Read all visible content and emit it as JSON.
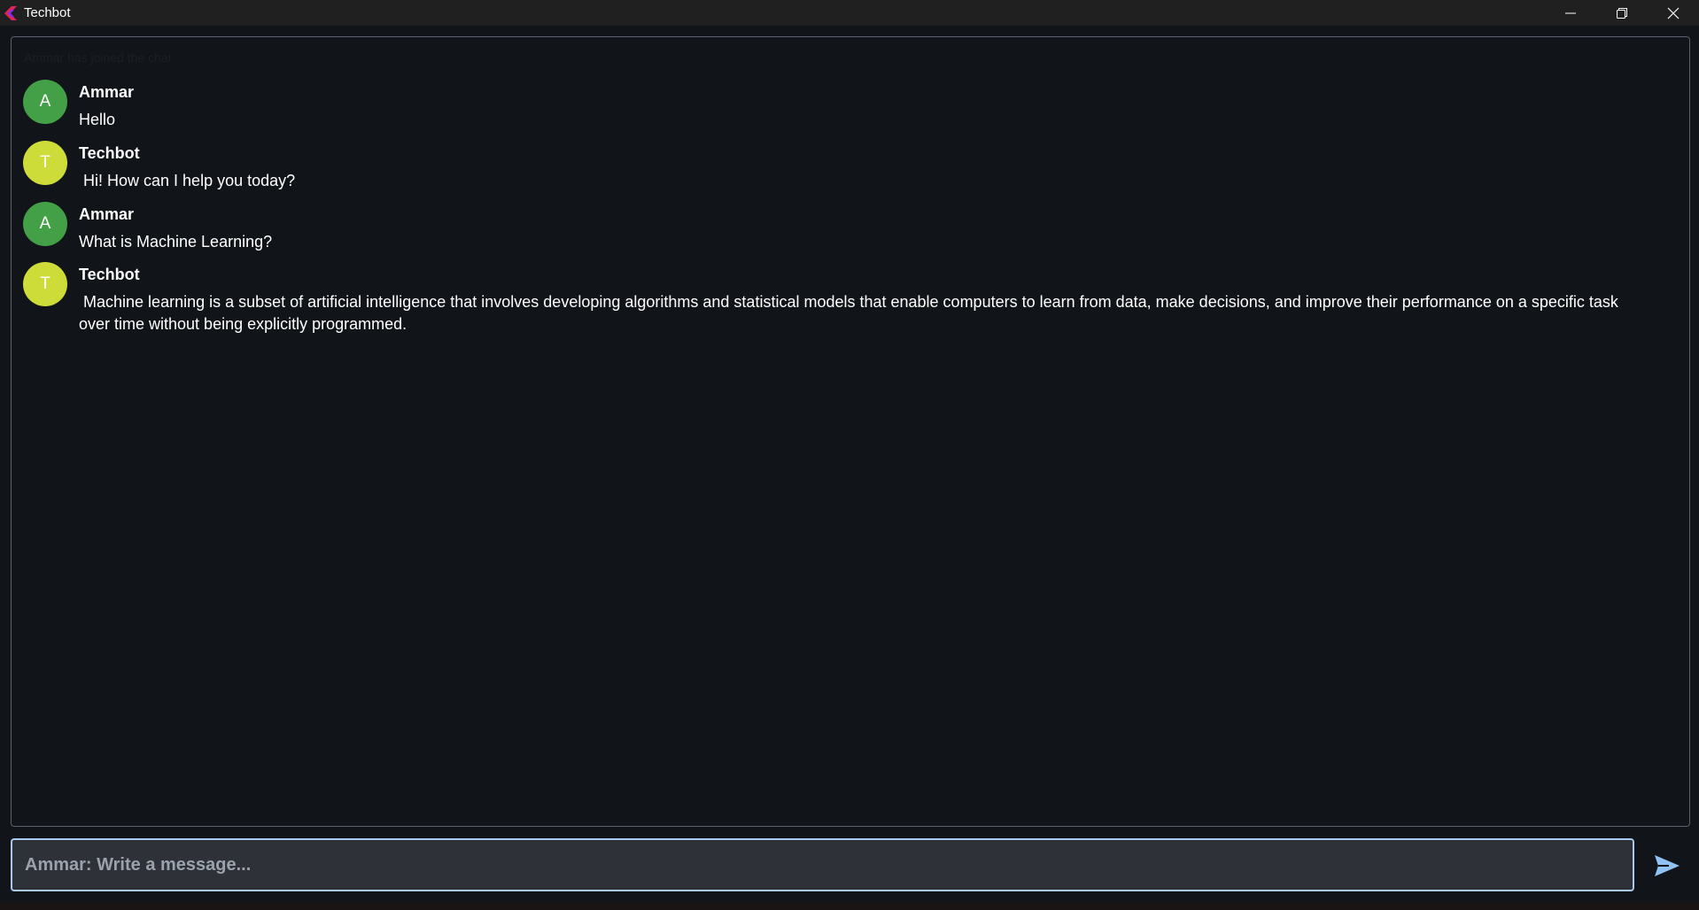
{
  "window": {
    "title": "Techbot"
  },
  "chat": {
    "system_notice": "Ammar has joined the chat",
    "messages": [
      {
        "author": "Ammar",
        "initial": "A",
        "text": "Hello",
        "avatar_color": "#43a047"
      },
      {
        "author": "Techbot",
        "initial": "T",
        "text": " Hi! How can I help you today?",
        "avatar_color": "#cddc39"
      },
      {
        "author": "Ammar",
        "initial": "A",
        "text": "What is Machine Learning?",
        "avatar_color": "#43a047"
      },
      {
        "author": "Techbot",
        "initial": "T",
        "text": " Machine learning is a subset of artificial intelligence that involves developing algorithms and statistical models that enable computers to learn from data, make decisions, and improve their performance on a specific task over time without being explicitly programmed.",
        "avatar_color": "#cddc39"
      }
    ]
  },
  "composer": {
    "placeholder": "Ammar: Write a message...",
    "value": ""
  },
  "icons": {
    "send": "send-icon",
    "minimize": "minimize-icon",
    "restore": "restore-icon",
    "close": "close-icon"
  },
  "colors": {
    "background": "#111419",
    "titlebar": "#202020",
    "panel_border": "#5a6270",
    "input_border": "#a8c8f0",
    "input_background": "#2e3137",
    "send_icon": "#90c2f5",
    "user_avatar": "#43a047",
    "bot_avatar": "#cddc39"
  }
}
